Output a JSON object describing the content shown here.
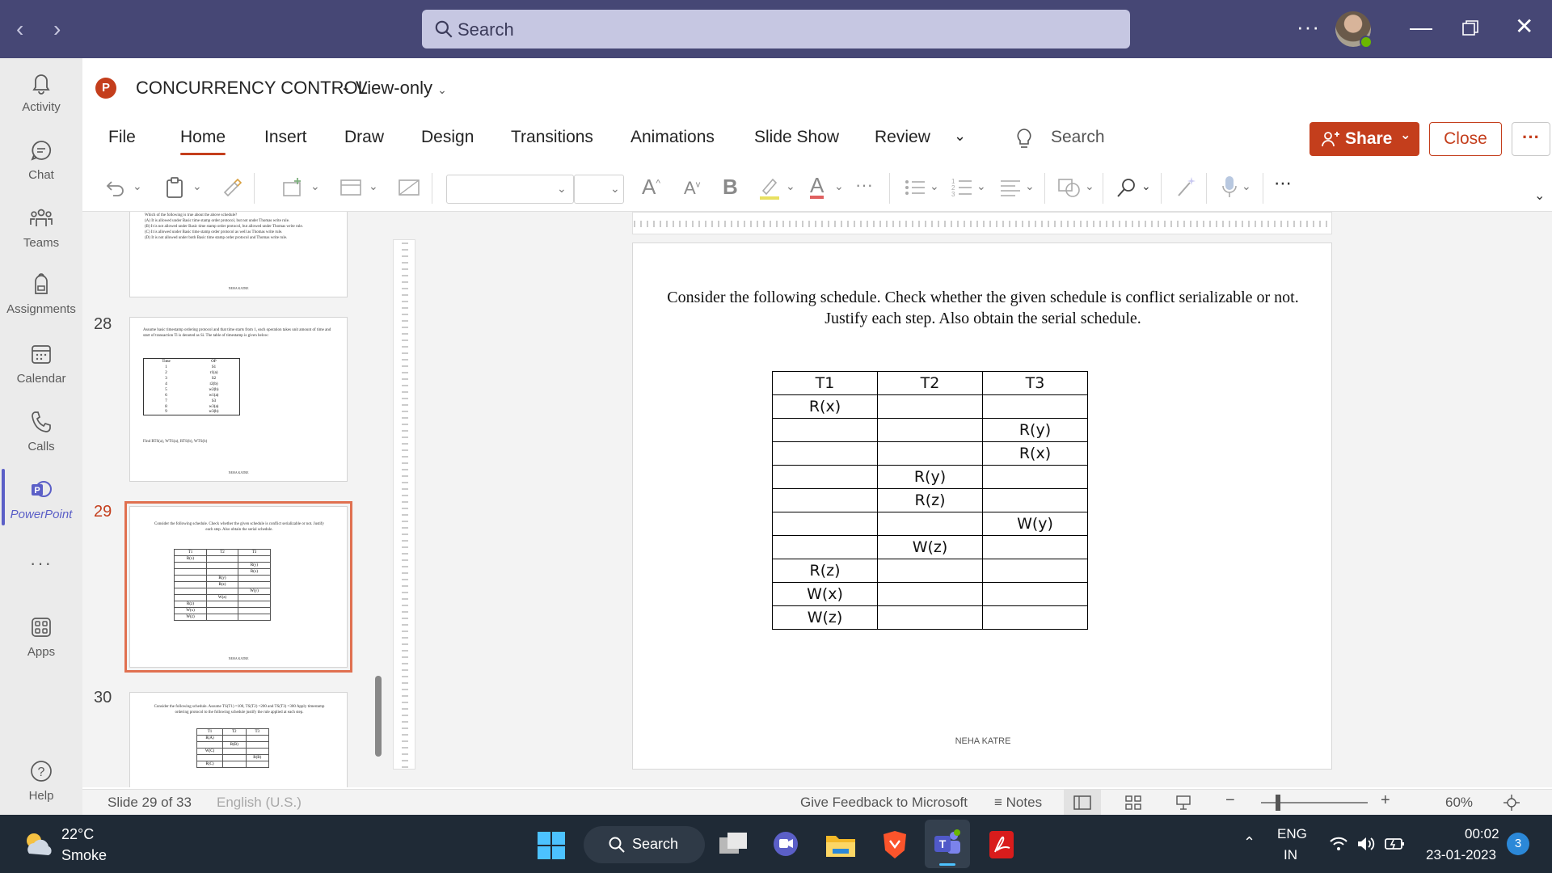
{
  "titlebar": {
    "search_placeholder": "Search",
    "more": "···"
  },
  "rail": [
    {
      "label": "Activity"
    },
    {
      "label": "Chat"
    },
    {
      "label": "Teams"
    },
    {
      "label": "Assignments"
    },
    {
      "label": "Calendar"
    },
    {
      "label": "Calls"
    },
    {
      "label": "PowerPoint"
    },
    {
      "label": "···"
    },
    {
      "label": "Apps"
    },
    {
      "label": "Help"
    }
  ],
  "document": {
    "title": "CONCURRENCY CONTROL",
    "separator": "-",
    "mode": "View-only"
  },
  "tabs": [
    "File",
    "Home",
    "Insert",
    "Draw",
    "Design",
    "Transitions",
    "Animations",
    "Slide Show",
    "Review"
  ],
  "ribbon_search": "Search",
  "buttons": {
    "share": "Share",
    "close": "Close",
    "more": "···"
  },
  "toolbar": {
    "font_grow": "A",
    "font_shrink": "A",
    "bold": "B",
    "font_color": "A",
    "more": "···"
  },
  "thumbnails": {
    "slide27": {
      "lines": [
        "Which of the following is true about the above schedule?",
        "(A) It is allowed under Basic time stamp order protocol, but not under Thomas write rule.",
        "(B) It is not allowed under Basic time stamp order protocol, but allowed under Thomas write rule.",
        "(C) It is allowed under Basic time stamp order protocol as well as Thomas write rule.",
        "(D) It is not allowed under both Basic time stamp order protocol and Thomas write rule."
      ],
      "footer": "NEHA KATRE"
    },
    "slide28": {
      "number": "28",
      "text": "Assume basic timestamp ordering protocol and that time starts from 1, each operation takes unit amount of time and start of transaction Ti is denoted as Si. The table of timestamp is given below:",
      "headers": [
        "Time",
        "OP"
      ],
      "rows": [
        [
          "1",
          "S1"
        ],
        [
          "2",
          "r1(a)"
        ],
        [
          "3",
          "S2"
        ],
        [
          "4",
          "r2(b)"
        ],
        [
          "5",
          "w2(b)"
        ],
        [
          "6",
          "w1(a)"
        ],
        [
          "7",
          "S3"
        ],
        [
          "8",
          "w3(a)"
        ],
        [
          "9",
          "w3(b)"
        ]
      ],
      "question": "Find RTS(a), WTS(a), RTS(b), WTS(b)",
      "footer": "NEHA KATRE"
    },
    "slide29": {
      "number": "29",
      "text": "Consider the following schedule. Check whether the given schedule is conflict serializable or not. Justify each step. Also obtain the serial schedule.",
      "footer": "NEHA KATRE"
    },
    "slide30": {
      "number": "30",
      "text": "Consider the following schedule. Assume TS(T1) =100, TS(T2) =200 and TS(T3) =300 Apply timestamp ordering protocol to the following schedule justify the rule applied at each step.",
      "headers": [
        "T1",
        "T2",
        "T3"
      ],
      "rows": [
        [
          "R(A)",
          "",
          ""
        ],
        [
          "",
          "R(B)",
          ""
        ],
        [
          "W(C)",
          "",
          ""
        ],
        [
          "",
          "",
          "R(B)"
        ],
        [
          "R(C)",
          "",
          ""
        ]
      ]
    }
  },
  "slide": {
    "text": "Consider the following schedule. Check whether the given schedule is conflict serializable or not. Justify each step. Also obtain the serial schedule.",
    "headers": [
      "T1",
      "T2",
      "T3"
    ],
    "rows": [
      [
        "R(x)",
        "",
        ""
      ],
      [
        "",
        "",
        "R(y)"
      ],
      [
        "",
        "",
        "R(x)"
      ],
      [
        "",
        "R(y)",
        ""
      ],
      [
        "",
        "R(z)",
        ""
      ],
      [
        "",
        "",
        "W(y)"
      ],
      [
        "",
        "W(z)",
        ""
      ],
      [
        "R(z)",
        "",
        ""
      ],
      [
        "W(x)",
        "",
        ""
      ],
      [
        "W(z)",
        "",
        ""
      ]
    ],
    "footer": "NEHA KATRE"
  },
  "status": {
    "slide_count": "Slide 29 of 33",
    "language": "English (U.S.)",
    "feedback": "Give Feedback to Microsoft",
    "notes": "Notes",
    "zoom": "60%",
    "zoom_minus": "−",
    "zoom_plus": "+"
  },
  "taskbar": {
    "weather_temp": "22°C",
    "weather_desc": "Smoke",
    "search": "Search",
    "lang_1": "ENG",
    "lang_2": "IN",
    "time": "00:02",
    "date": "23-01-2023",
    "notifications": "3"
  },
  "colors": {
    "titlebar": "#464775",
    "accent": "#c43e1c",
    "rail_active": "#5b5fc7"
  }
}
